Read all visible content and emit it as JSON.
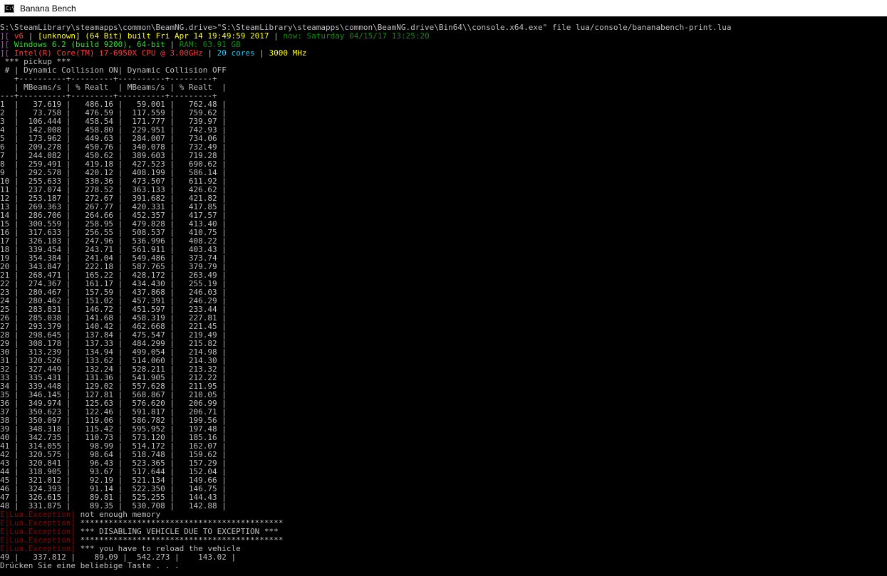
{
  "window": {
    "title": "Banana Bench"
  },
  "console": {
    "command_line": "S:\\SteamLibrary\\steamapps\\common\\BeamNG.drive>\"S:\\SteamLibrary\\steamapps\\common\\BeamNG.drive\\Bin64\\\\console.x64.exe\" file lua/console/bananabench-print.lua",
    "info_lines": [
      [
        {
          "t": "][ ",
          "c": "magenta"
        },
        {
          "t": "v6",
          "c": "red"
        },
        {
          "t": " | ",
          "c": "white"
        },
        {
          "t": "[unknown] (64 Bit) built Fri Apr 14 19:49:59 2017",
          "c": "yellow"
        },
        {
          "t": " | ",
          "c": "white"
        },
        {
          "t": "now: Saturday 04/15/17 13:25:20",
          "c": "dgreen"
        }
      ],
      [
        {
          "t": "][ ",
          "c": "magenta"
        },
        {
          "t": "Windows 6.2 (build 9200), 64-bit",
          "c": "green"
        },
        {
          "t": " | ",
          "c": "white"
        },
        {
          "t": "RAM: 63.91 GB",
          "c": "dgreen"
        }
      ],
      [
        {
          "t": "][ ",
          "c": "magenta"
        },
        {
          "t": "Intel(R) Core(TM) i7-6950X CPU @ 3.00GHz",
          "c": "red"
        },
        {
          "t": " | ",
          "c": "white"
        },
        {
          "t": "20 cores",
          "c": "cyan"
        },
        {
          "t": " | ",
          "c": "white"
        },
        {
          "t": "3000 MHz",
          "c": "yellow"
        }
      ]
    ],
    "section_title": " *** pickup ***",
    "header_lines": [
      " # | Dynamic Collision ON| Dynamic Collision OFF",
      "   +----------+---------+----------+---------+",
      "   | MBeams/s | % Realt  | MBeams/s | % Realt  |",
      "---+----------+---------+----------+---------+"
    ],
    "rows": [
      [
        "1",
        "37.619",
        "486.16",
        "59.001",
        "762.48"
      ],
      [
        "2",
        "73.758",
        "476.59",
        "117.559",
        "759.62"
      ],
      [
        "3",
        "106.444",
        "458.54",
        "171.777",
        "739.97"
      ],
      [
        "4",
        "142.008",
        "458.80",
        "229.951",
        "742.93"
      ],
      [
        "5",
        "173.962",
        "449.63",
        "284.007",
        "734.06"
      ],
      [
        "6",
        "209.278",
        "450.76",
        "340.078",
        "732.49"
      ],
      [
        "7",
        "244.082",
        "450.62",
        "389.603",
        "719.28"
      ],
      [
        "8",
        "259.491",
        "419.18",
        "427.523",
        "690.62"
      ],
      [
        "9",
        "292.578",
        "420.12",
        "408.199",
        "586.14"
      ],
      [
        "10",
        "255.633",
        "330.36",
        "473.507",
        "611.92"
      ],
      [
        "11",
        "237.074",
        "278.52",
        "363.133",
        "426.62"
      ],
      [
        "12",
        "253.187",
        "272.67",
        "391.682",
        "421.82"
      ],
      [
        "13",
        "269.363",
        "267.77",
        "420.331",
        "417.85"
      ],
      [
        "14",
        "286.706",
        "264.66",
        "452.357",
        "417.57"
      ],
      [
        "15",
        "300.559",
        "258.95",
        "479.828",
        "413.40"
      ],
      [
        "16",
        "317.633",
        "256.55",
        "508.537",
        "410.75"
      ],
      [
        "17",
        "326.183",
        "247.96",
        "536.996",
        "408.22"
      ],
      [
        "18",
        "339.454",
        "243.71",
        "561.911",
        "403.43"
      ],
      [
        "19",
        "354.384",
        "241.04",
        "549.486",
        "373.74"
      ],
      [
        "20",
        "343.847",
        "222.18",
        "587.765",
        "379.79"
      ],
      [
        "21",
        "268.471",
        "165.22",
        "428.172",
        "263.49"
      ],
      [
        "22",
        "274.367",
        "161.17",
        "434.430",
        "255.19"
      ],
      [
        "23",
        "280.467",
        "157.59",
        "437.868",
        "246.03"
      ],
      [
        "24",
        "280.462",
        "151.02",
        "457.391",
        "246.29"
      ],
      [
        "25",
        "283.831",
        "146.72",
        "451.597",
        "233.44"
      ],
      [
        "26",
        "285.038",
        "141.68",
        "458.319",
        "227.81"
      ],
      [
        "27",
        "293.379",
        "140.42",
        "462.668",
        "221.45"
      ],
      [
        "28",
        "298.645",
        "137.84",
        "475.547",
        "219.49"
      ],
      [
        "29",
        "308.178",
        "137.33",
        "484.299",
        "215.82"
      ],
      [
        "30",
        "313.239",
        "134.94",
        "499.054",
        "214.98"
      ],
      [
        "31",
        "320.526",
        "133.62",
        "514.060",
        "214.30"
      ],
      [
        "32",
        "327.449",
        "132.24",
        "528.211",
        "213.32"
      ],
      [
        "33",
        "335.431",
        "131.36",
        "541.905",
        "212.22"
      ],
      [
        "34",
        "339.448",
        "129.02",
        "557.628",
        "211.95"
      ],
      [
        "35",
        "346.145",
        "127.81",
        "568.867",
        "210.05"
      ],
      [
        "36",
        "349.974",
        "125.63",
        "576.620",
        "206.99"
      ],
      [
        "37",
        "350.623",
        "122.46",
        "591.817",
        "206.71"
      ],
      [
        "38",
        "350.097",
        "119.06",
        "586.782",
        "199.56"
      ],
      [
        "39",
        "348.318",
        "115.42",
        "595.952",
        "197.48"
      ],
      [
        "40",
        "342.735",
        "110.73",
        "573.120",
        "185.16"
      ],
      [
        "41",
        "314.055",
        "98.99",
        "514.172",
        "162.07"
      ],
      [
        "42",
        "320.575",
        "98.64",
        "518.748",
        "159.62"
      ],
      [
        "43",
        "320.841",
        "96.43",
        "523.365",
        "157.29"
      ],
      [
        "44",
        "318.905",
        "93.67",
        "517.644",
        "152.04"
      ],
      [
        "45",
        "321.012",
        "92.19",
        "521.134",
        "149.66"
      ],
      [
        "46",
        "324.393",
        "91.14",
        "522.350",
        "146.75"
      ],
      [
        "47",
        "326.615",
        "89.81",
        "525.255",
        "144.43"
      ],
      [
        "48",
        "331.875",
        "89.35",
        "530.708",
        "142.88"
      ]
    ],
    "exceptions": [
      {
        "prefix": "E|Lua.Exception|",
        "msg": " not enough memory"
      },
      {
        "prefix": "E|Lua.Exception|",
        "msg": " *******************************************"
      },
      {
        "prefix": "E|Lua.Exception|",
        "msg": " *** DISABLING VEHICLE DUE TO EXCEPTION ***"
      },
      {
        "prefix": "E|Lua.Exception|",
        "msg": " *******************************************"
      },
      {
        "prefix": "E|Lua.Exception|",
        "msg": " *** you have to reload the vehicle"
      }
    ],
    "final_row": "49 |   337.812 |    89.09 |  542.273 |    143.02 |",
    "prompt": "Drücken Sie eine beliebige Taste . . ."
  }
}
